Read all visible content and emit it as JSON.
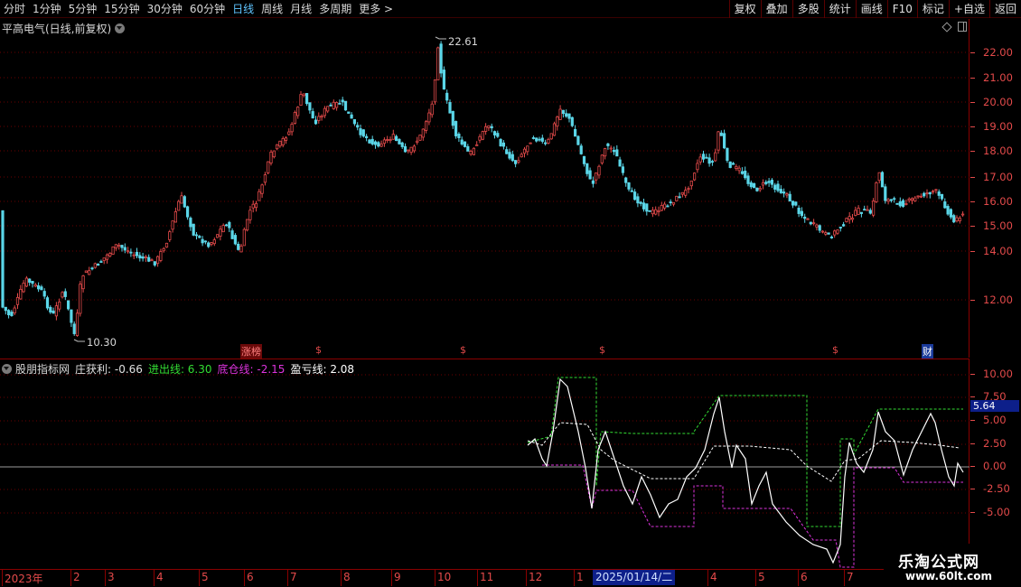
{
  "toolbar": {
    "periods": [
      {
        "label": "分时",
        "active": false
      },
      {
        "label": "1分钟",
        "active": false
      },
      {
        "label": "5分钟",
        "active": false
      },
      {
        "label": "15分钟",
        "active": false
      },
      {
        "label": "30分钟",
        "active": false
      },
      {
        "label": "60分钟",
        "active": false
      },
      {
        "label": "日线",
        "active": true
      },
      {
        "label": "周线",
        "active": false
      },
      {
        "label": "月线",
        "active": false
      },
      {
        "label": "多周期",
        "active": false
      },
      {
        "label": "更多 >",
        "active": false
      }
    ],
    "buttons": [
      "复权",
      "叠加",
      "多股",
      "统计",
      "画线",
      "F10",
      "标记",
      "+自选",
      "返回"
    ]
  },
  "main_chart": {
    "title": "平高电气(日线,前复权)",
    "price_ticks": [
      "22.00",
      "21.00",
      "20.00",
      "19.00",
      "18.00",
      "17.00",
      "16.00",
      "15.00",
      "14.00",
      "12.00"
    ],
    "high_label": "22.61",
    "low_label": "10.30",
    "event_markers": [
      {
        "label": "涨榜",
        "color": "#ff8080"
      },
      {
        "label": "$",
        "color": "#e34a4a"
      },
      {
        "label": "$",
        "color": "#e34a4a"
      },
      {
        "label": "$",
        "color": "#e34a4a"
      },
      {
        "label": "$",
        "color": "#e34a4a"
      },
      {
        "label": "财",
        "color": "#ffffff"
      }
    ],
    "up_color": "#e34a4a",
    "down_color": "#5bd6e8"
  },
  "indicator": {
    "name": "股朋指标网",
    "legend": [
      {
        "label": "庄获利:",
        "value": "-0.66",
        "color": "#e0e0e0"
      },
      {
        "label": "进出线:",
        "value": "6.30",
        "color": "#33dd33"
      },
      {
        "label": "底仓线:",
        "value": "-2.15",
        "color": "#dd33dd"
      },
      {
        "label": "盈亏线:",
        "value": "2.08",
        "color": "#ffffff"
      }
    ],
    "ticks": [
      "10.00",
      "7.50",
      "5.00",
      "2.50",
      "0.00",
      "-2.50",
      "-5.00"
    ],
    "current_value": "5.64"
  },
  "date_axis": {
    "labels": [
      "2023年",
      "2",
      "3",
      "4",
      "5",
      "6",
      "7",
      "8",
      "9",
      "10",
      "11",
      "12",
      "1",
      "2025/01/14/二",
      "4",
      "5",
      "6",
      "7"
    ]
  },
  "watermark": {
    "title": "乐淘公式网",
    "url": "www.60lt.com"
  }
}
